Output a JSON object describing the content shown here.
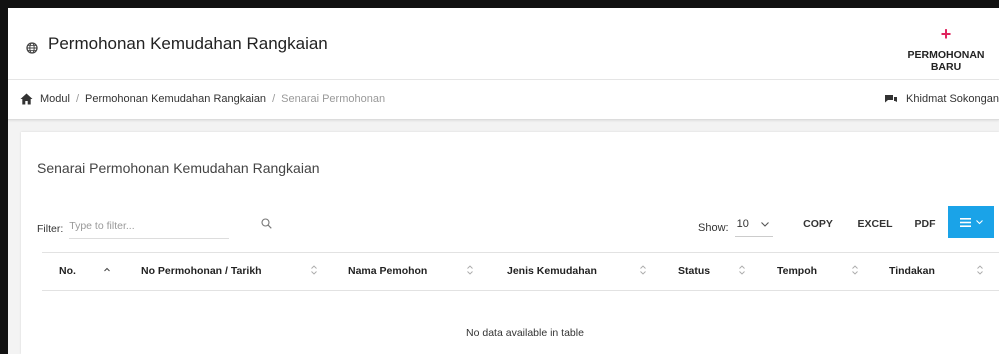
{
  "header": {
    "title": "Permohonan Kemudahan Rangkaian",
    "new_button": {
      "icon": "plus-icon",
      "label": "PERMOHONAN BARU"
    },
    "title_icon": "globe-icon"
  },
  "breadcrumb": {
    "home_icon": "home-icon",
    "items": [
      "Modul",
      "Permohonan Kemudahan Rangkaian",
      "Senarai Permohonan"
    ],
    "separator": "/"
  },
  "service": {
    "icon": "chat-icon",
    "label": "Khidmat Sokongan"
  },
  "card": {
    "title": "Senarai Permohonan Kemudahan Rangkaian",
    "filter": {
      "label": "Filter:",
      "placeholder": "Type to filter...",
      "value": ""
    },
    "show": {
      "label": "Show:",
      "value": "10"
    },
    "buttons": {
      "copy": "COPY",
      "excel": "EXCEL",
      "pdf": "PDF"
    },
    "accent_color": "#1aa3e8"
  },
  "table": {
    "columns": [
      "No.",
      "No Permohonan / Tarikh",
      "Nama Pemohon",
      "Jenis Kemudahan",
      "Status",
      "Tempoh",
      "Tindakan"
    ],
    "rows": [],
    "empty_message": "No data available in table"
  },
  "colors": {
    "accent_red": "#e0245e",
    "accent_blue": "#1aa3e8"
  }
}
